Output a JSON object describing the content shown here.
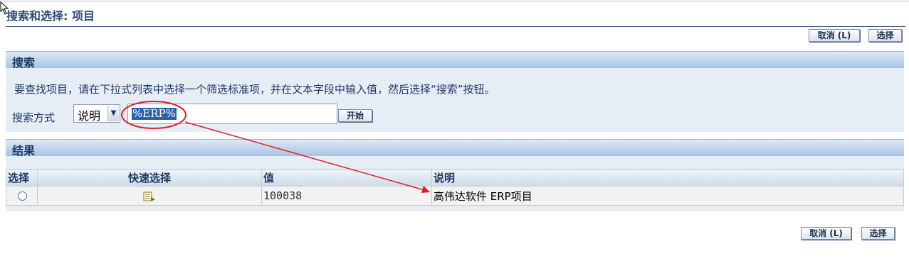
{
  "page": {
    "title": "搜索和选择: 项目"
  },
  "buttons": {
    "cancel": "取消 (L)",
    "select": "选择",
    "go": "开始"
  },
  "search": {
    "header": "搜索",
    "instructions": "要查找项目，请在下拉式列表中选择一个筛选标准项，并在文本字段中输入值，然后选择“搜索”按钮。",
    "search_by_label": "搜索方式",
    "filter_selected": "说明",
    "query_value": "%ERP%"
  },
  "results": {
    "header": "结果",
    "columns": [
      "选择",
      "快速选择",
      "值",
      "说明"
    ],
    "rows": [
      {
        "value": "100038",
        "description": "高伟达软件 ERP项目"
      }
    ]
  },
  "annotation": {
    "color": "#e02020"
  }
}
